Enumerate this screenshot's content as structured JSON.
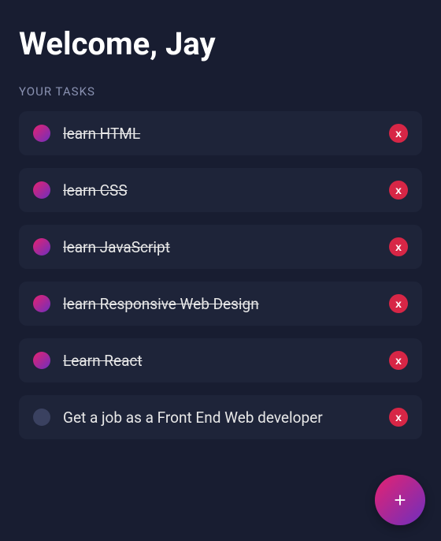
{
  "header": {
    "title": "Welcome, Jay"
  },
  "section": {
    "label": "YOUR TASKS"
  },
  "tasks": [
    {
      "text": "learn HTML",
      "done": true
    },
    {
      "text": "learn CSS",
      "done": true
    },
    {
      "text": "learn JavaScript",
      "done": true
    },
    {
      "text": "learn Responsive Web Design",
      "done": true
    },
    {
      "text": "Learn React",
      "done": true
    },
    {
      "text": "Get a job as a Front End Web developer",
      "done": false
    }
  ],
  "buttons": {
    "delete_label": "x",
    "add_label": "+"
  }
}
